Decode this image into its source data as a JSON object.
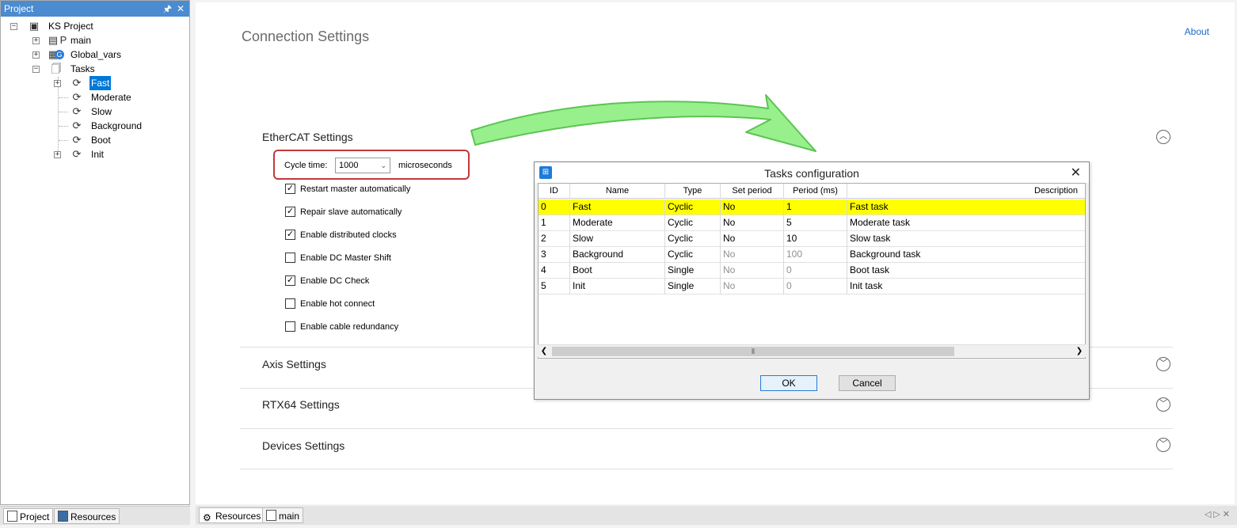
{
  "project_panel": {
    "title": "Project",
    "tree": {
      "root": "KS Project",
      "main": "main",
      "global_vars": "Global_vars",
      "tasks": "Tasks",
      "task_items": [
        "Fast",
        "Moderate",
        "Slow",
        "Background",
        "Boot",
        "Init"
      ],
      "selected": "Fast"
    },
    "bottom_tabs": [
      "Project",
      "Resources"
    ]
  },
  "main": {
    "title": "Connection Settings",
    "about": "About",
    "ethercat": {
      "title": "EtherCAT Settings",
      "cycle_label": "Cycle time:",
      "cycle_value": "1000",
      "cycle_unit": "microseconds",
      "options": [
        {
          "label": "Restart master automatically",
          "checked": true
        },
        {
          "label": "Repair slave automatically",
          "checked": true
        },
        {
          "label": "Enable distributed clocks",
          "checked": true
        },
        {
          "label": "Enable DC Master Shift",
          "checked": false
        },
        {
          "label": "Enable DC Check",
          "checked": true
        },
        {
          "label": "Enable hot connect",
          "checked": false
        },
        {
          "label": "Enable cable redundancy",
          "checked": false
        }
      ]
    },
    "sections": [
      "Axis Settings",
      "RTX64 Settings",
      "Devices Settings"
    ]
  },
  "dialog": {
    "title": "Tasks configuration",
    "columns": [
      "ID",
      "Name",
      "Type",
      "Set period",
      "Period (ms)",
      "Description"
    ],
    "rows": [
      {
        "id": "0",
        "name": "Fast",
        "type": "Cyclic",
        "set_period": "No",
        "period": "1",
        "description": "Fast task"
      },
      {
        "id": "1",
        "name": "Moderate",
        "type": "Cyclic",
        "set_period": "No",
        "period": "5",
        "description": "Moderate task"
      },
      {
        "id": "2",
        "name": "Slow",
        "type": "Cyclic",
        "set_period": "No",
        "period": "10",
        "description": "Slow task"
      },
      {
        "id": "3",
        "name": "Background",
        "type": "Cyclic",
        "set_period": "No",
        "period": "100",
        "description": "Background task"
      },
      {
        "id": "4",
        "name": "Boot",
        "type": "Single",
        "set_period": "No",
        "period": "0",
        "description": "Boot task"
      },
      {
        "id": "5",
        "name": "Init",
        "type": "Single",
        "set_period": "No",
        "period": "0",
        "description": "Init task"
      }
    ],
    "ok": "OK",
    "cancel": "Cancel"
  },
  "bottom_doc_tabs": [
    "Resources",
    "main"
  ],
  "colors": {
    "highlight_row": "#ffff00",
    "arrow_fill": "#98f08c",
    "cycle_box_border": "#c0393b",
    "selection": "#0078d7"
  }
}
